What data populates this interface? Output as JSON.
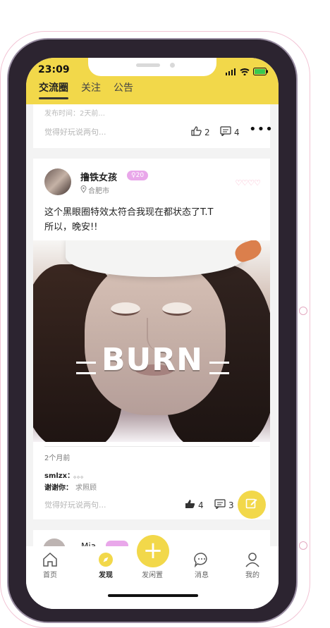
{
  "status_bar": {
    "time": "23:09"
  },
  "header": {
    "tabs": [
      {
        "label": "交流圈"
      },
      {
        "label": "关注"
      },
      {
        "label": "公告"
      }
    ]
  },
  "post1": {
    "truncated_text": "发布时间：2天前...",
    "comment_placeholder": "觉得好玩说两句...",
    "likes": "2",
    "comments": "4"
  },
  "post2": {
    "username": "撸铁女孩",
    "level_badge": "♀20",
    "location": "合肥市",
    "text": "这个黑眼圈特效太符合我现在都状态了T.T\n所以，晚安!!",
    "image_text": "BURN",
    "time_ago": "2个月前",
    "comments": [
      {
        "user": "smlzx：",
        "text": "。。。"
      },
      {
        "user": "谢谢你：",
        "text": "求照顾"
      }
    ],
    "comment_placeholder": "觉得好玩说两句...",
    "likes": "4",
    "comment_count": "3"
  },
  "post3": {
    "username": "Mia"
  },
  "tabbar": {
    "items": [
      {
        "label": "首页"
      },
      {
        "label": "发现"
      },
      {
        "label": "发闲置"
      },
      {
        "label": "消息"
      },
      {
        "label": "我的"
      }
    ]
  },
  "colors": {
    "accent": "#f2d84a",
    "badge": "#e9a7ea",
    "heart": "#f6a5bf"
  },
  "icons": {
    "location": "location-icon",
    "like": "thumbs-up-icon",
    "comment": "comment-icon",
    "edit": "edit-icon"
  }
}
